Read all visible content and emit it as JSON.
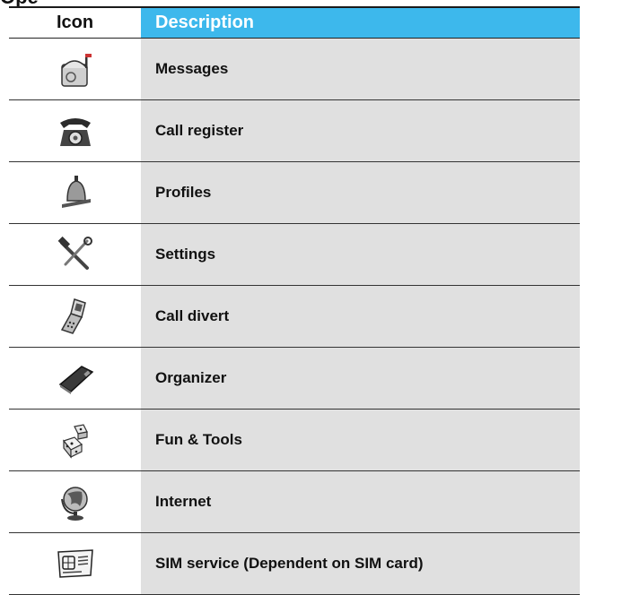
{
  "table": {
    "headers": {
      "icon": "Icon",
      "description": "Description"
    },
    "rows": [
      {
        "icon": "mailbox-icon",
        "label": "Messages"
      },
      {
        "icon": "telephone-icon",
        "label": "Call register"
      },
      {
        "icon": "bell-icon",
        "label": "Profiles"
      },
      {
        "icon": "tools-icon",
        "label": "Settings"
      },
      {
        "icon": "flip-phone-icon",
        "label": "Call divert"
      },
      {
        "icon": "organizer-icon",
        "label": "Organizer"
      },
      {
        "icon": "dice-icon",
        "label": "Fun & Tools"
      },
      {
        "icon": "globe-icon",
        "label": "Internet"
      },
      {
        "icon": "sim-card-icon",
        "label": "SIM service (Dependent on SIM card)"
      }
    ]
  },
  "colors": {
    "header_accent": "#3db8ec",
    "cell_gray": "#e0e0e0"
  }
}
